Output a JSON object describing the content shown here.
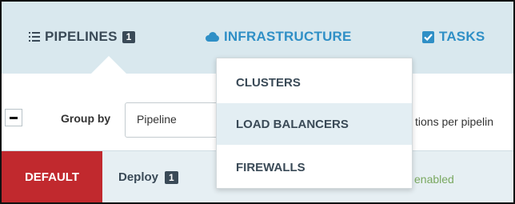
{
  "nav": {
    "pipelines_label": "PIPELINES",
    "pipelines_badge": "1",
    "infrastructure_label": "INFRASTRUCTURE",
    "tasks_label": "TASKS",
    "icons": [
      "list-icon",
      "cloud-icon",
      "checkbox-icon"
    ]
  },
  "toolbar": {
    "collapse_icon": "minus-icon",
    "group_by_label": "Group by",
    "group_by_value": "Pipeline",
    "trailing_text": "tions per pipelin"
  },
  "execution_row": {
    "tag": "DEFAULT",
    "pipeline_label": "Deploy",
    "pipeline_badge": "1",
    "status_text": "enabled"
  },
  "dropdown": {
    "items": [
      {
        "label": "CLUSTERS",
        "hovered": false
      },
      {
        "label": "LOAD BALANCERS",
        "hovered": true
      },
      {
        "label": "FIREWALLS",
        "hovered": false
      }
    ]
  },
  "colors": {
    "nav_background": "#d9e8ee",
    "link_blue": "#2f8fc6",
    "dark_text": "#3a4a57",
    "default_red": "#c1292e",
    "enabled_green": "#7aa860",
    "hover_background": "#e3eef3"
  }
}
